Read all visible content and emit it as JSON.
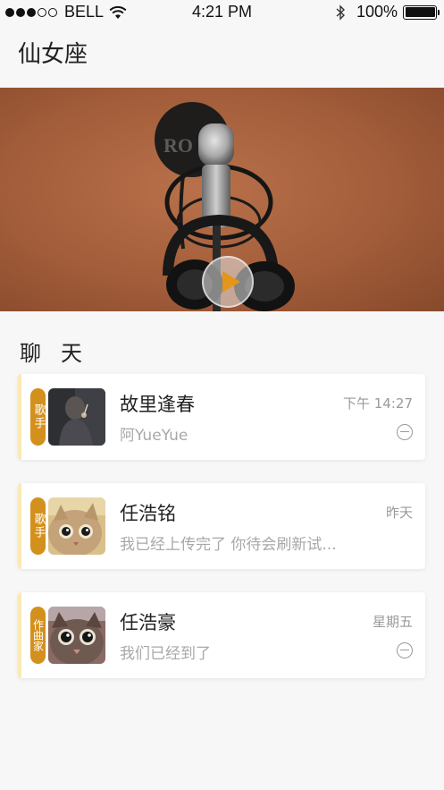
{
  "status_bar": {
    "carrier": "BELL",
    "time": "4:21 PM",
    "battery_percent": "100%",
    "battery_level": 1.0,
    "signal_bars_filled": 3,
    "signal_bars_total": 5
  },
  "header": {
    "title": "仙女座"
  },
  "hero": {
    "play_icon": "play-icon",
    "accent_color": "#e39619"
  },
  "chat_section": {
    "title": "聊天"
  },
  "chats": [
    {
      "role": "歌手",
      "name": "故里逢春",
      "preview": "阿YueYue",
      "time": "下午 14:27",
      "muted": true,
      "avatar": "person-photo"
    },
    {
      "role": "歌手",
      "name": "任浩铭",
      "preview": "我已经上传完了 你待会刷新试...",
      "time": "昨天",
      "muted": false,
      "avatar": "cat-photo"
    },
    {
      "role": "作曲家",
      "name": "任浩豪",
      "preview": "我们已经到了",
      "time": "星期五",
      "muted": true,
      "avatar": "cat-photo"
    }
  ],
  "colors": {
    "tag": "#d4901d",
    "accent_bar": "#fbe9b5",
    "hero_bg": "#a35d3a"
  }
}
